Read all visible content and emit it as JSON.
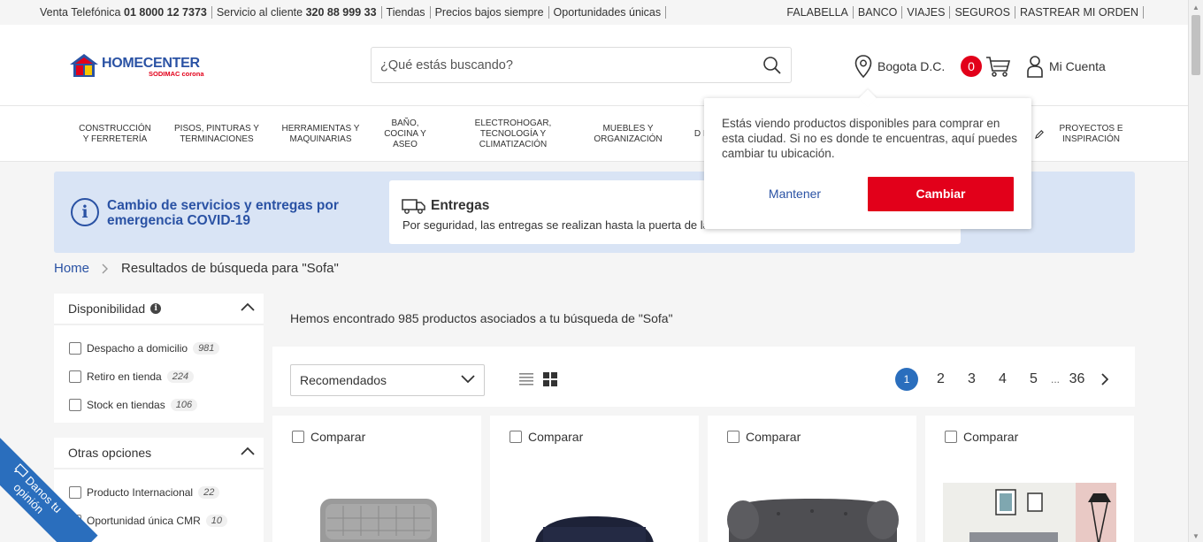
{
  "topbar": {
    "sales_label": "Venta Telefónica",
    "sales_number": "01 8000 12 7373",
    "service_label": "Servicio al cliente",
    "service_number": "320 88 999 33",
    "links_left": [
      "Tiendas",
      "Precios bajos siempre",
      "Oportunidades únicas"
    ],
    "links_right": [
      "FALABELLA",
      "BANCO",
      "VIAJES",
      "SEGUROS",
      "RASTREAR MI ORDEN"
    ]
  },
  "header": {
    "logo_text": "HOMECENTER",
    "logo_sub": "SODIMAC corona",
    "search_placeholder": "¿Qué estás buscando?",
    "location": "Bogota D.C.",
    "cart_count": "0",
    "account": "Mi Cuenta"
  },
  "categories": [
    "CONSTRUCCIÓN Y FERRETERÍA",
    "PISOS, PINTURAS Y TERMINACIONES",
    "HERRAMIENTAS Y MAQUINARIAS",
    "BAÑO, COCINA Y ASEO",
    "ELECTROHOGAR, TECNOLOGÍA Y CLIMATIZACIÓN",
    "MUEBLES Y ORGANIZACIÓN",
    "D IL",
    "PROYECTOS E INSPIRACIÓN"
  ],
  "banner": {
    "title": "Cambio de servicios y entregas por emergencia COVID-19",
    "card_title": "Entregas",
    "card_text": "Por seguridad, las entregas se realizan hasta la puerta de la ca"
  },
  "breadcrumb": {
    "home": "Home",
    "current": "Resultados de búsqueda para \"Sofa\""
  },
  "filters": {
    "availability": {
      "title": "Disponibilidad",
      "items": [
        {
          "label": "Despacho a domicilio",
          "count": "981"
        },
        {
          "label": "Retiro en tienda",
          "count": "224"
        },
        {
          "label": "Stock en tiendas",
          "count": "106"
        }
      ]
    },
    "other": {
      "title": "Otras opciones",
      "items": [
        {
          "label": "Producto Internacional",
          "count": "22"
        },
        {
          "label": "Oportunidad única CMR",
          "count": "10"
        }
      ]
    }
  },
  "results": {
    "summary": "Hemos encontrado 985 productos asociados a tu búsqueda de \"Sofa\"",
    "sort_value": "Recomendados",
    "pages": [
      "1",
      "2",
      "3",
      "4",
      "5",
      "...",
      "36"
    ],
    "current_page": "1",
    "compare_label": "Comparar"
  },
  "popup": {
    "text": "Estás viendo productos disponibles para comprar en esta ciudad. Si no es donde te encuentras, aquí puedes cambiar tu ubicación.",
    "keep": "Mantener",
    "change": "Cambiar"
  },
  "feedback": {
    "line1": "Danos tu",
    "line2": "opinión"
  },
  "colors": {
    "brand_blue": "#2a52a4",
    "brand_red": "#e2001a",
    "banner_bg": "#d9e4f5",
    "page_active": "#2a6ebd"
  }
}
